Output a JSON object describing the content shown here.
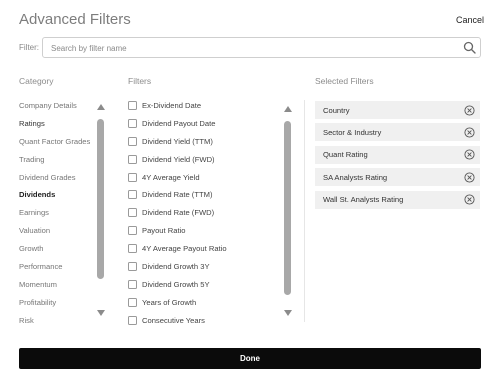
{
  "header": {
    "title": "Advanced Filters",
    "cancel_label": "Cancel"
  },
  "search": {
    "label": "Filter:",
    "placeholder": "Search by filter name"
  },
  "columns": {
    "category": "Category",
    "filters": "Filters",
    "selected": "Selected Filters"
  },
  "categories": [
    {
      "label": "Company Details",
      "active": false
    },
    {
      "label": "Ratings",
      "active": false
    },
    {
      "label": "Quant Factor Grades",
      "active": false
    },
    {
      "label": "Trading",
      "active": false
    },
    {
      "label": "Dividend Grades",
      "active": false
    },
    {
      "label": "Dividends",
      "active": true
    },
    {
      "label": "Earnings",
      "active": false
    },
    {
      "label": "Valuation",
      "active": false
    },
    {
      "label": "Growth",
      "active": false
    },
    {
      "label": "Performance",
      "active": false
    },
    {
      "label": "Momentum",
      "active": false
    },
    {
      "label": "Profitability",
      "active": false
    },
    {
      "label": "Risk",
      "active": false
    }
  ],
  "filters": [
    {
      "label": "Ex-Dividend Date",
      "checked": false
    },
    {
      "label": "Dividend Payout Date",
      "checked": false
    },
    {
      "label": "Dividend Yield (TTM)",
      "checked": false
    },
    {
      "label": "Dividend Yield (FWD)",
      "checked": false
    },
    {
      "label": "4Y Average Yield",
      "checked": false
    },
    {
      "label": "Dividend Rate (TTM)",
      "checked": false
    },
    {
      "label": "Dividend Rate (FWD)",
      "checked": false
    },
    {
      "label": "Payout Ratio",
      "checked": false
    },
    {
      "label": "4Y Average Payout Ratio",
      "checked": false
    },
    {
      "label": "Dividend Growth 3Y",
      "checked": false
    },
    {
      "label": "Dividend Growth 5Y",
      "checked": false
    },
    {
      "label": "Years of Growth",
      "checked": false
    },
    {
      "label": "Consecutive Years",
      "checked": false
    }
  ],
  "selected": [
    {
      "label": "Country"
    },
    {
      "label": "Sector & Industry"
    },
    {
      "label": "Quant Rating"
    },
    {
      "label": "SA Analysts Rating"
    },
    {
      "label": "Wall St. Analysts Rating"
    }
  ],
  "footer": {
    "done_label": "Done"
  },
  "icons": {
    "search": "search-icon",
    "remove": "circle-x-icon",
    "scroll_up": "triangle-up-icon",
    "scroll_down": "triangle-down-icon"
  },
  "colors": {
    "done_button": "#0b0b0b",
    "selected_chip": "#f0f0f0",
    "scroll_thumb": "#a8a8a8"
  }
}
